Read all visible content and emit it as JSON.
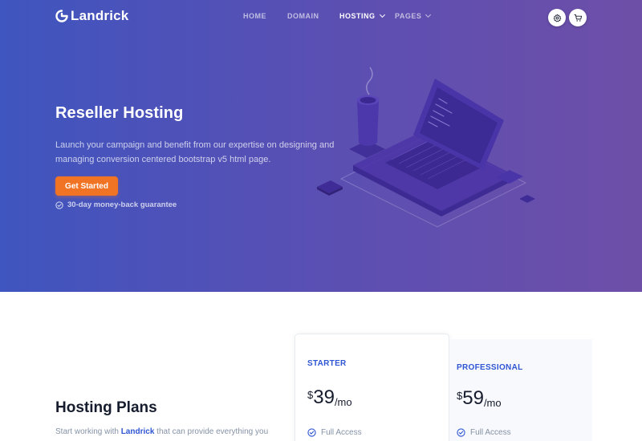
{
  "brand": {
    "name": "Landrick"
  },
  "nav": {
    "items": [
      {
        "label": "HOME",
        "has_caret": false
      },
      {
        "label": "DOMAIN",
        "has_caret": false
      },
      {
        "label": "HOSTING",
        "has_caret": true
      },
      {
        "label": "PAGES",
        "has_caret": true
      }
    ],
    "active": "HOSTING",
    "actions": [
      "settings-icon",
      "cart-icon"
    ]
  },
  "hero": {
    "title": "Reseller Hosting",
    "description": "Launch your campaign and benefit from our expertise on designing and managing conversion centered bootstrap v5 html page.",
    "cta_label": "Get Started",
    "guarantee": "30-day money-back guarantee"
  },
  "plans_section": {
    "title": "Hosting Plans",
    "desc_prefix": "Start working with",
    "desc_brand": "Landrick",
    "desc_suffix": "that can provide everything you"
  },
  "plans": [
    {
      "name": "STARTER",
      "currency": "$",
      "price": "39",
      "period": "/mo",
      "feature": "Full Access"
    },
    {
      "name": "PROFESSIONAL",
      "currency": "$",
      "price": "59",
      "period": "/mo",
      "feature": "Full Access"
    }
  ],
  "colors": {
    "hero_start": "#3f55bf",
    "hero_end": "#6e4fa8",
    "accent": "#f17425",
    "primary": "#2f55d4",
    "heading": "#161c2d",
    "muted": "#8492a6"
  }
}
